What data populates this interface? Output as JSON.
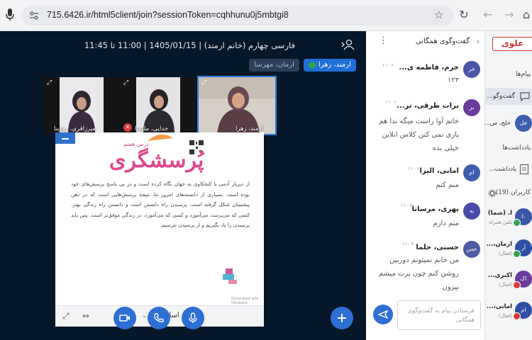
{
  "browser": {
    "url": "715.6426.ir/html5client/join?sessionToken=cqhhunu0j5mbtgi8"
  },
  "meeting": {
    "title": "فارسی چهارم (خانم ارمند) | 1405/01/15 | 11:00 تا 11:45",
    "talking": [
      "ارمند، زهرا",
      "ارمان، مهرسا"
    ]
  },
  "cameras": [
    {
      "name": "میرزاقری، روژینا"
    },
    {
      "name": "خدایی، ملیسا"
    },
    {
      "name": "ارمند، زهرا"
    }
  ],
  "slide": {
    "heading": "پُرسشگری",
    "subheading": "درس هفتم",
    "body": "از دیرباز آدمی با کنجکاوی به جهان نگاه کرده است و در پی پاسخ پرسش‌های خود بوده است. بسیاری از دانسته‌های امروز ما، نتیجهٔ پرسش‌هایی است که در ذهن پیشینیان شکل گرفته است. پرسیدن راه دانستن است و دانستن راه زندگی بهتر. کسی که می‌پرسد، می‌آموزد و کسی که می‌آموزد، در زندگی موفق‌تر است. پس باید پرسیدن را یاد بگیریم و از پرسیدن نترسیم.",
    "footer": "Generated with Ottobase",
    "page_label": "اسلاید 1"
  },
  "chat": {
    "title": "گفت‌وگوی همگانی",
    "input_placeholder": "فرستادن پیام به گفت‌وگوی همگانی",
    "messages": [
      {
        "initials": "خر",
        "name": "خرم، فاطمه ی...",
        "time": "۱۱:۰۶",
        "text": "۱۲۳",
        "color": "#4b55a8"
      },
      {
        "initials": "بر",
        "name": "برات طرقی، تر...",
        "time": "۱۱:۰۶",
        "text": "خانم آوا راست میگه ندا هم پاری نمی کنن کلاس انلاین خیلی بده",
        "color": "#6a3a9c"
      },
      {
        "initials": "ام",
        "name": "امانی، الیزا",
        "time": "۱۱:۰۶",
        "text": "منم کنم",
        "color": "#3e5fae"
      },
      {
        "initials": "به",
        "name": "بهری، مرسانا",
        "time": "۱۱:۰۷",
        "text": "منم دارم",
        "color": "#4a4ba8"
      },
      {
        "initials": "حس",
        "name": "حسنی، حلما",
        "time": "۱۱:۰۷",
        "text": "من خانم نمیتونم دوربین روشن کنم چون پرت میشم بیرون",
        "color": "#4d5aa6"
      }
    ]
  },
  "nav": {
    "logo": "علوی",
    "messages_label": "پیام‌ها",
    "chat_label": "گفت‌وگو...",
    "private_chat": "خلج، س...",
    "notes_section": "یادداشت‌ها",
    "notes_label": "یادداشت...",
    "users_label": "کاربران (19)",
    "participants": [
      {
        "initials": "ا.",
        "name": "ا. (شما)",
        "sub": "تلفن همراه",
        "color": "#3b58a6",
        "badge": "#2fa44f"
      },
      {
        "initials": "آر",
        "name": "ارمان،...",
        "sub": "(فعال)",
        "color": "#2f4fa6",
        "badge": "#2fa44f"
      },
      {
        "initials": "اک",
        "name": "اکبری...",
        "sub": "(فعال)",
        "color": "#6a3a9c",
        "badge": "#d93a3a"
      },
      {
        "initials": "ام",
        "name": "امانی،...",
        "sub": "(فعال)",
        "color": "#2f4fa6",
        "badge": "#d93a3a"
      }
    ]
  }
}
